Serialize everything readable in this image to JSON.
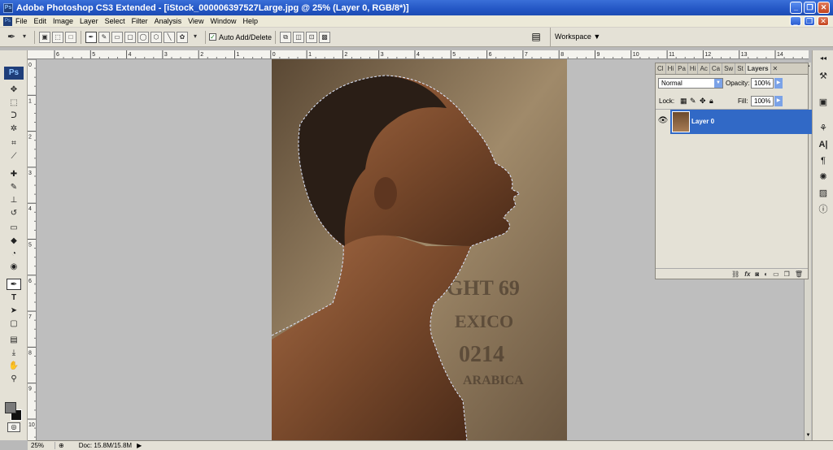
{
  "window": {
    "title": "Adobe Photoshop CS3 Extended - [iStock_000006397527Large.jpg @ 25% (Layer 0, RGB/8*)]",
    "app_icon_text": "Ps",
    "buttons": {
      "minimize": "_",
      "restore": "❐",
      "close": "✕"
    }
  },
  "menu": {
    "items": [
      "File",
      "Edit",
      "Image",
      "Layer",
      "Select",
      "Filter",
      "Analysis",
      "View",
      "Window",
      "Help"
    ]
  },
  "options": {
    "auto_add_delete_label": "Auto Add/Delete",
    "auto_add_delete_checked": true,
    "workspace_label": "Workspace ▼"
  },
  "toolbox": {
    "logo": "Ps",
    "tools": [
      {
        "name": "move-tool",
        "glyph": "✥"
      },
      {
        "name": "marquee-tool",
        "glyph": "⬚"
      },
      {
        "name": "lasso-tool",
        "glyph": "ᑐ"
      },
      {
        "name": "magic-wand-tool",
        "glyph": "✲"
      },
      {
        "name": "crop-tool",
        "glyph": "⌗"
      },
      {
        "name": "slice-tool",
        "glyph": "⟋"
      },
      {
        "name": "healing-brush-tool",
        "glyph": "✚"
      },
      {
        "name": "brush-tool",
        "glyph": "✎"
      },
      {
        "name": "clone-stamp-tool",
        "glyph": "⊥"
      },
      {
        "name": "history-brush-tool",
        "glyph": "↺"
      },
      {
        "name": "eraser-tool",
        "glyph": "▭"
      },
      {
        "name": "paint-bucket-tool",
        "glyph": "◆"
      },
      {
        "name": "blur-tool",
        "glyph": "◔"
      },
      {
        "name": "dodge-tool",
        "glyph": "◉"
      },
      {
        "name": "pen-tool",
        "glyph": "✒"
      },
      {
        "name": "type-tool",
        "glyph": "T"
      },
      {
        "name": "path-selection-tool",
        "glyph": "➤"
      },
      {
        "name": "shape-tool",
        "glyph": "▢"
      },
      {
        "name": "notes-tool",
        "glyph": "▤"
      },
      {
        "name": "eyedropper-tool",
        "glyph": "⤓"
      },
      {
        "name": "hand-tool",
        "glyph": "✋"
      },
      {
        "name": "zoom-tool",
        "glyph": "⚲"
      }
    ]
  },
  "rulers": {
    "top_numbers": [
      "6",
      "5",
      "4",
      "3",
      "2",
      "1",
      "0",
      "1",
      "2",
      "3",
      "4",
      "5",
      "6",
      "7",
      "8",
      "9",
      "10",
      "11",
      "12",
      "13",
      "14"
    ],
    "left_numbers": [
      "0",
      "1",
      "2",
      "3",
      "4",
      "5",
      "6",
      "7",
      "8",
      "9",
      "10"
    ]
  },
  "layers_panel": {
    "tabs": [
      "Cl",
      "Hi",
      "Pa",
      "Hi",
      "Ac",
      "Ca",
      "Sw",
      "St",
      "Layers"
    ],
    "active_tab": "Layers",
    "blend_mode": "Normal",
    "opacity_label": "Opacity:",
    "opacity_value": "100%",
    "lock_label": "Lock:",
    "fill_label": "Fill:",
    "fill_value": "100%",
    "layers": [
      {
        "name": "Layer 0",
        "visible": true,
        "selected": true
      }
    ],
    "close_glyph": "✕"
  },
  "status": {
    "zoom": "25%",
    "doc": "Doc: 15.8M/15.8M"
  },
  "colors": {
    "selection_blue": "#3169c6",
    "panel_bg": "#e4e1d6",
    "canvas_bg": "#bebebe"
  }
}
